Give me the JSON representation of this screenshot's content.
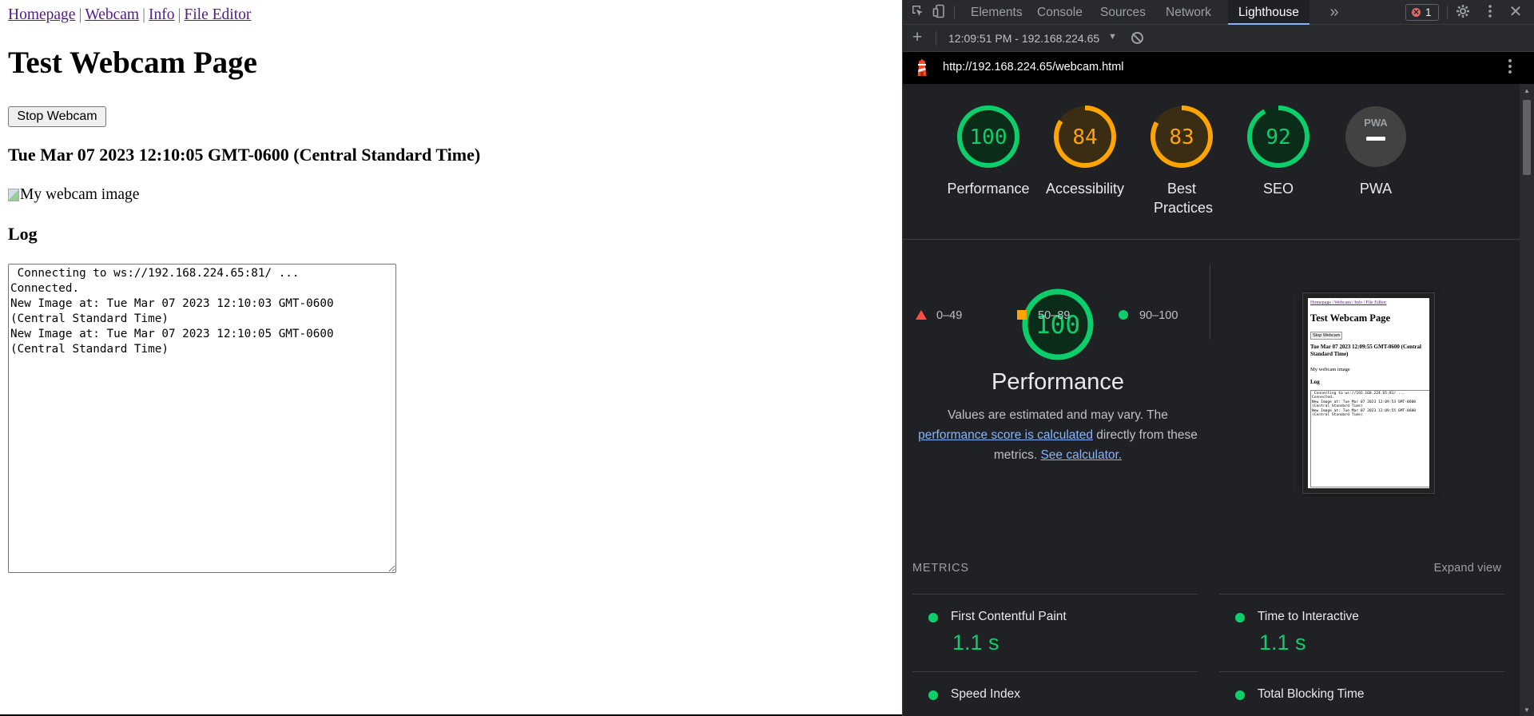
{
  "page": {
    "nav": [
      "Homepage",
      "Webcam",
      "Info",
      "File Editor"
    ],
    "title": "Test Webcam Page",
    "stop_button": "Stop Webcam",
    "datetime": "Tue Mar 07 2023 12:10:05 GMT-0600 (Central Standard Time)",
    "image_alt": "My webcam image",
    "log_heading": "Log",
    "log_text": " Connecting to ws://192.168.224.65:81/ ...\nConnected.\nNew Image at: Tue Mar 07 2023 12:10:03 GMT-0600\n(Central Standard Time)\nNew Image at: Tue Mar 07 2023 12:10:05 GMT-0600\n(Central Standard Time)"
  },
  "devtools": {
    "tabs": [
      "Elements",
      "Console",
      "Sources",
      "Network",
      "Lighthouse"
    ],
    "active_tab": "Lighthouse",
    "error_count": "1",
    "report_label": "12:09:51 PM - 192.168.224.65",
    "report_url": "http://192.168.224.65/webcam.html",
    "scores": [
      {
        "label": "Performance",
        "score": 100,
        "color": "#0cce6b",
        "bg": "#0c2c1a"
      },
      {
        "label": "Accessibility",
        "score": 84,
        "color": "#ffa400",
        "bg": "#3b2d14"
      },
      {
        "label": "Best Practices",
        "score": 83,
        "color": "#ffa400",
        "bg": "#3b2d14"
      },
      {
        "label": "SEO",
        "score": 92,
        "color": "#0cce6b",
        "bg": "#0c2c1a"
      },
      {
        "label": "PWA",
        "score": null,
        "badge": "PWA",
        "color": "#9aa0a6",
        "bg": "#424242"
      }
    ],
    "perf": {
      "score": "100",
      "title": "Performance",
      "desc_1": "Values are estimated and may vary. The",
      "desc_link_1": "performance score is calculated",
      "desc_2": "directly from these metrics.",
      "desc_link_2": "See calculator."
    },
    "legend": [
      "0–49",
      "50–89",
      "90–100"
    ],
    "legend_colors": {
      "fail": "#ff4e42",
      "average": "#ffa400",
      "pass": "#0cce6b"
    },
    "thumbnail": {
      "nav": "Homepage | Webcam | Info | File Editor",
      "title": "Test Webcam Page",
      "button": "Stop Webcam",
      "datetime": "Tue Mar 07 2023 12:09:55 GMT-0600 (Central Standard Time)",
      "image_alt": "My webcam image",
      "log_heading": "Log",
      "log_text": " Connecting to ws://192.168.224.65:81/ ...\nConnected.\nNew Image at: Tue Mar 07 2023 12:09:53 GMT-0600\n(Central Standard Time)\nNew Image at: Tue Mar 07 2023 12:09:55 GMT-0600\n(Central Standard Time)"
    },
    "metrics_heading": "METRICS",
    "expand_label": "Expand view",
    "metrics": [
      {
        "name": "First Contentful Paint",
        "value": "1.1 s"
      },
      {
        "name": "Time to Interactive",
        "value": "1.1 s"
      },
      {
        "name": "Speed Index",
        "value": ""
      },
      {
        "name": "Total Blocking Time",
        "value": ""
      }
    ]
  }
}
